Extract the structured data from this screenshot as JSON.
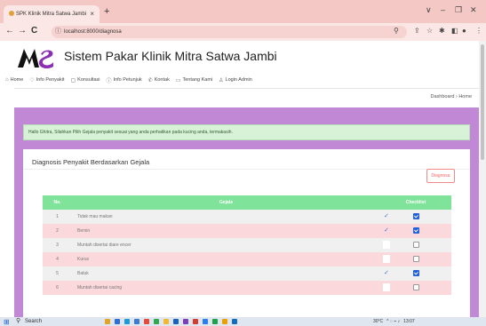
{
  "browser": {
    "tab_title": "SPK Klinik Mitra Satwa Jambi",
    "tab_close": "×",
    "new_tab": "+",
    "back": "←",
    "forward": "→",
    "reload": "C",
    "url": "localhost:8000/diagnosa",
    "win_min": "∨",
    "win_restore": "–",
    "win_max": "❐",
    "win_close": "✕"
  },
  "header": {
    "title": "Sistem Pakar Klinik Mitra Satwa Jambi"
  },
  "nav": [
    {
      "label": "Home",
      "icon": "home-icon"
    },
    {
      "label": "Info Penyakit",
      "icon": "heart-icon"
    },
    {
      "label": "Konsultasi",
      "icon": "document-icon"
    },
    {
      "label": "Info Petunjuk",
      "icon": "info-icon"
    },
    {
      "label": "Kontak",
      "icon": "phone-icon"
    },
    {
      "label": "Tentang Kami",
      "icon": "monitor-icon"
    },
    {
      "label": "Login Admin",
      "icon": "user-icon"
    }
  ],
  "breadcrumb": {
    "parent": "Dashboard",
    "separator": "›",
    "current": "Home"
  },
  "alert": "Hallo Ghitra, Silahkan Pilih Gejala penyakit sesuai yang anda perhatikan pada kucing anda, termakasih.",
  "card": {
    "title": "Diagnosis Penyakit Berdasarkan Gejala",
    "diagnosa_button": "Diagnosa"
  },
  "table": {
    "headers": [
      "No.",
      "Gejala",
      "Checklist"
    ],
    "rows": [
      {
        "no": "1",
        "gejala": "Tidak mau makan",
        "checked": true
      },
      {
        "no": "2",
        "gejala": "Bersin",
        "checked": true
      },
      {
        "no": "3",
        "gejala": "Muntah disertai diare encer",
        "checked": false
      },
      {
        "no": "4",
        "gejala": "Kurus",
        "checked": false
      },
      {
        "no": "5",
        "gejala": "Batuk",
        "checked": true
      },
      {
        "no": "6",
        "gejala": "Muntah disertai cacing",
        "checked": false
      }
    ]
  },
  "taskbar": {
    "search": "Search",
    "weather": "30°C",
    "time": "13:07"
  },
  "colors": {
    "content_bg": "#c188d6",
    "table_header": "#7fe39a",
    "row_pink": "#fbd8dc",
    "alert_bg": "#d7f2d7"
  }
}
